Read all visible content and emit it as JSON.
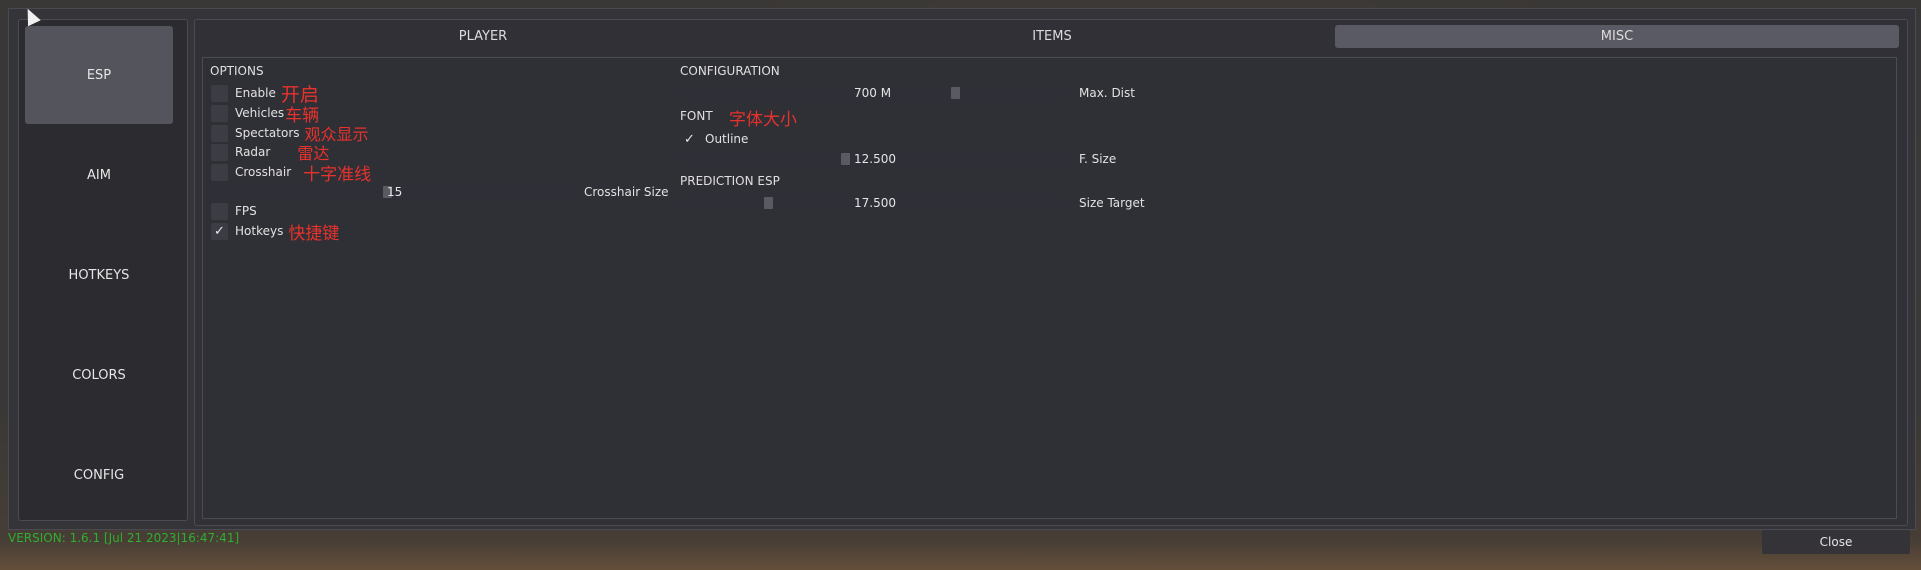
{
  "sidebar": {
    "items": [
      {
        "label": "ESP",
        "active": true
      },
      {
        "label": "AIM",
        "active": false
      },
      {
        "label": "HOTKEYS",
        "active": false
      },
      {
        "label": "COLORS",
        "active": false
      },
      {
        "label": "CONFIG",
        "active": false
      }
    ]
  },
  "tabs": [
    {
      "label": "PLAYER",
      "active": false
    },
    {
      "label": "ITEMS",
      "active": false
    },
    {
      "label": "MISC",
      "active": true
    }
  ],
  "options": {
    "title": "OPTIONS",
    "items": [
      {
        "label": "Enable",
        "checked": false,
        "annotation": "开启"
      },
      {
        "label": "Vehicles",
        "checked": false,
        "annotation": "车辆"
      },
      {
        "label": "Spectators",
        "checked": false,
        "annotation": "观众显示"
      },
      {
        "label": "Radar",
        "checked": false,
        "annotation": "雷达"
      },
      {
        "label": "Crosshair",
        "checked": false,
        "annotation": "十字准线"
      },
      {
        "label": "FPS",
        "checked": false
      },
      {
        "label": "Hotkeys",
        "checked": true,
        "annotation": "快捷键"
      }
    ],
    "crosshair_size": {
      "label": "Crosshair Size",
      "value": "15"
    }
  },
  "configuration": {
    "title": "CONFIGURATION",
    "max_dist": {
      "label": "Max. Dist",
      "value": "700 M"
    },
    "font_title": "FONT",
    "font_annotation": "字体大小",
    "outline": {
      "label": "Outline",
      "checked": true
    },
    "font_size": {
      "label": "F. Size",
      "value": "12.500"
    },
    "prediction_title": "PREDICTION ESP",
    "size_target": {
      "label": "Size Target",
      "value": "17.500"
    }
  },
  "footer": {
    "version": "VERSION: 1.6.1 [Jul 21 2023|16:47:41]",
    "close_label": "Close"
  },
  "colors": {
    "annotation": "#e8322c",
    "version": "#2fae2f",
    "active_tab": "#5a5a64"
  }
}
